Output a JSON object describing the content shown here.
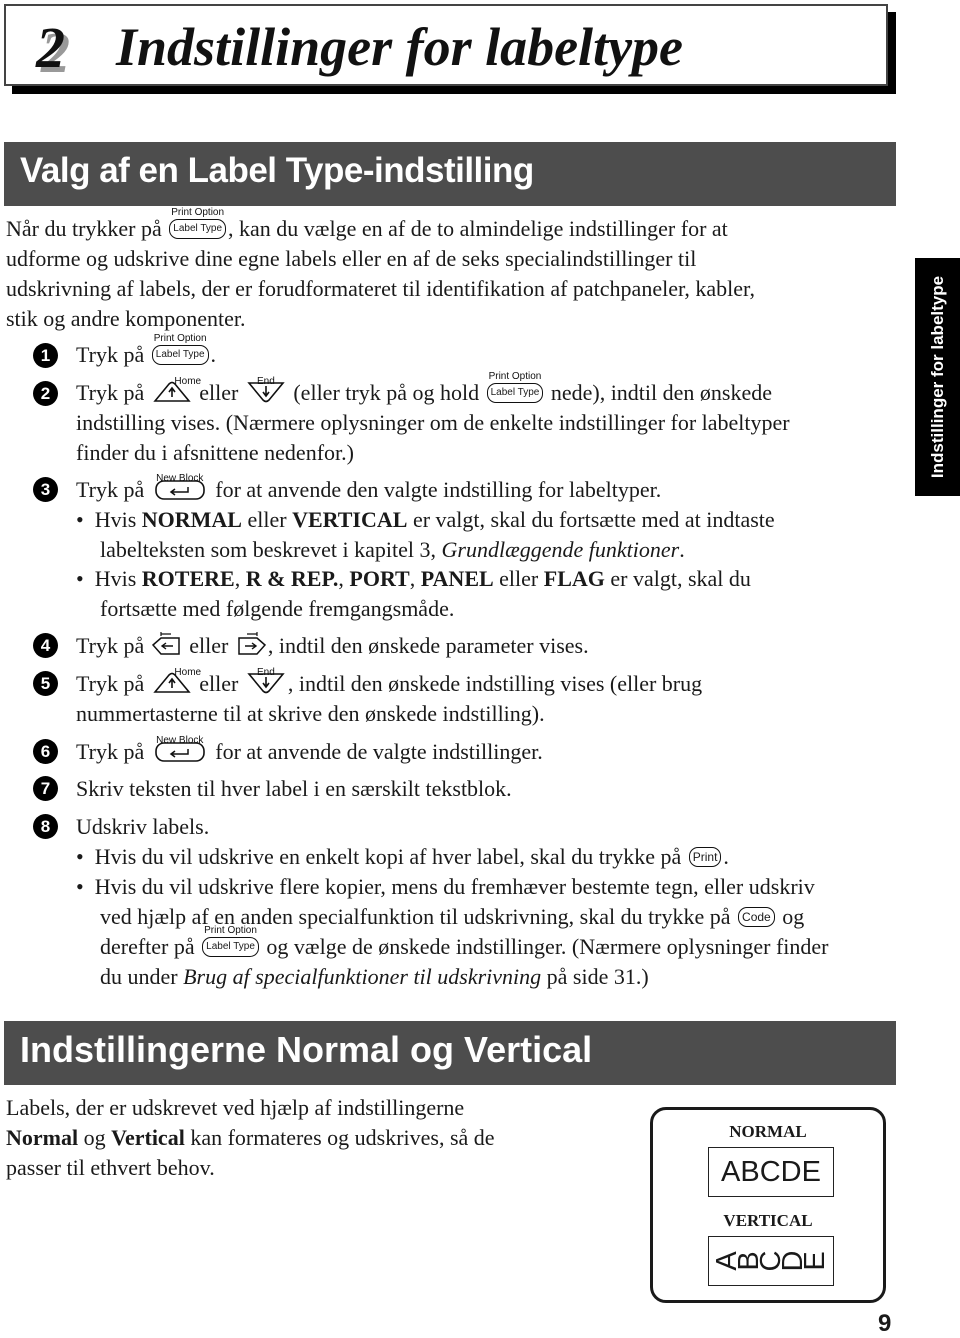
{
  "chapter": {
    "number": "2",
    "title": "Indstillinger for labeltype"
  },
  "side_tab": "Indstillinger for labeltype",
  "keys": {
    "label_type": "Label Type",
    "print_option": "Print Option",
    "home": "Home",
    "end": "End",
    "new_block": "New Block",
    "print": "Print",
    "code": "Code"
  },
  "section1": {
    "title": "Valg af en Label Type-indstilling",
    "intro": [
      [
        "Når du trykker på ",
        "{label_type}",
        ", kan du vælge en af de to almindelige indstillinger for at"
      ],
      [
        "udforme og udskrive dine egne labels eller en af de seks specialindstillinger til"
      ],
      [
        "udskrivning af labels, der er forudformateret til identifikation af patchpaneler, kabler,"
      ],
      [
        "stik og andre komponenter."
      ]
    ],
    "steps": [
      {
        "num": "1",
        "lines": [
          "Tryk på",
          "."
        ]
      },
      {
        "num": "2",
        "lines": [
          "Tryk på",
          "eller",
          "(eller tryk på og hold",
          "nede), indtil den ønskede",
          "indstilling vises. (Nærmere oplysninger om de enkelte indstillinger for labeltyper",
          "finder du i afsnittene nedenfor.)"
        ]
      },
      {
        "num": "3",
        "lines": [
          "Tryk på",
          "for at anvende den valgte indstilling for labeltyper."
        ]
      },
      {
        "num": "4",
        "lines": [
          "Tryk på",
          "eller",
          ", indtil den ønskede parameter vises."
        ]
      },
      {
        "num": "5",
        "lines": [
          "Tryk på",
          "eller",
          ", indtil den ønskede indstilling vises (eller brug",
          "nummertasterne til at skrive den ønskede indstilling)."
        ]
      },
      {
        "num": "6",
        "lines": [
          "Tryk på",
          "for at anvende de valgte indstillinger."
        ]
      },
      {
        "num": "7",
        "lines": [
          "Skriv teksten til hver label i en særskilt tekstblok."
        ]
      },
      {
        "num": "8",
        "lines": [
          "Udskriv labels."
        ]
      }
    ],
    "step3_bullets": {
      "b1": {
        "pre": "Hvis ",
        "bold1": "NORMAL",
        "mid": " eller ",
        "bold2": "VERTICAL",
        "post": " er valgt, skal du fortsætte med at indtaste",
        "line2_pre": "labelteksten som beskrevet i kapitel 3, ",
        "line2_italic": "Grundlæggende funktioner",
        "line2_post": "."
      },
      "b2": {
        "pre": "Hvis ",
        "bold1": "ROTERE",
        "sep1": ", ",
        "bold2": "R & REP.",
        "sep2": ", ",
        "bold3": "PORT",
        "sep3": ", ",
        "bold4": "PANEL",
        "mid": " eller ",
        "bold5": "FLAG",
        "post": " er valgt, skal du",
        "line2": "fortsætte med følgende fremgangsmåde."
      }
    },
    "step8_bullets": {
      "b1": {
        "text": "Hvis du vil udskrive en enkelt kopi af hver label, skal du trykke på",
        "post": "."
      },
      "b2": {
        "line1": "Hvis du vil udskrive flere kopier, mens du fremhæver bestemte tegn, eller udskriv",
        "line2": "ved hjælp af en anden specialfunktion til udskrivning, skal du trykke på",
        "line2_post": "og",
        "line3_pre": "derefter på",
        "line3_post": "og vælge de ønskede indstillinger. (Nærmere oplysninger finder",
        "line4_pre": "du under ",
        "line4_italic": "Brug af specialfunktioner til udskrivning",
        "line4_post": " på side 31.)"
      }
    }
  },
  "section2": {
    "title": "Indstillingerne Normal og Vertical",
    "body": {
      "line1": "Labels, der er udskrevet ved hjælp af indstillingerne",
      "bold1": "Normal",
      "mid": " og ",
      "bold2": "Vertical",
      "line2_post": " kan formateres og udskrives, så de",
      "line3": "passer til ethvert behov."
    },
    "figure": {
      "normal_label": "NORMAL",
      "normal_sample": "ABCDE",
      "vertical_label": "VERTICAL",
      "vertical_sample": "ABCDE"
    }
  },
  "page_number": "9"
}
